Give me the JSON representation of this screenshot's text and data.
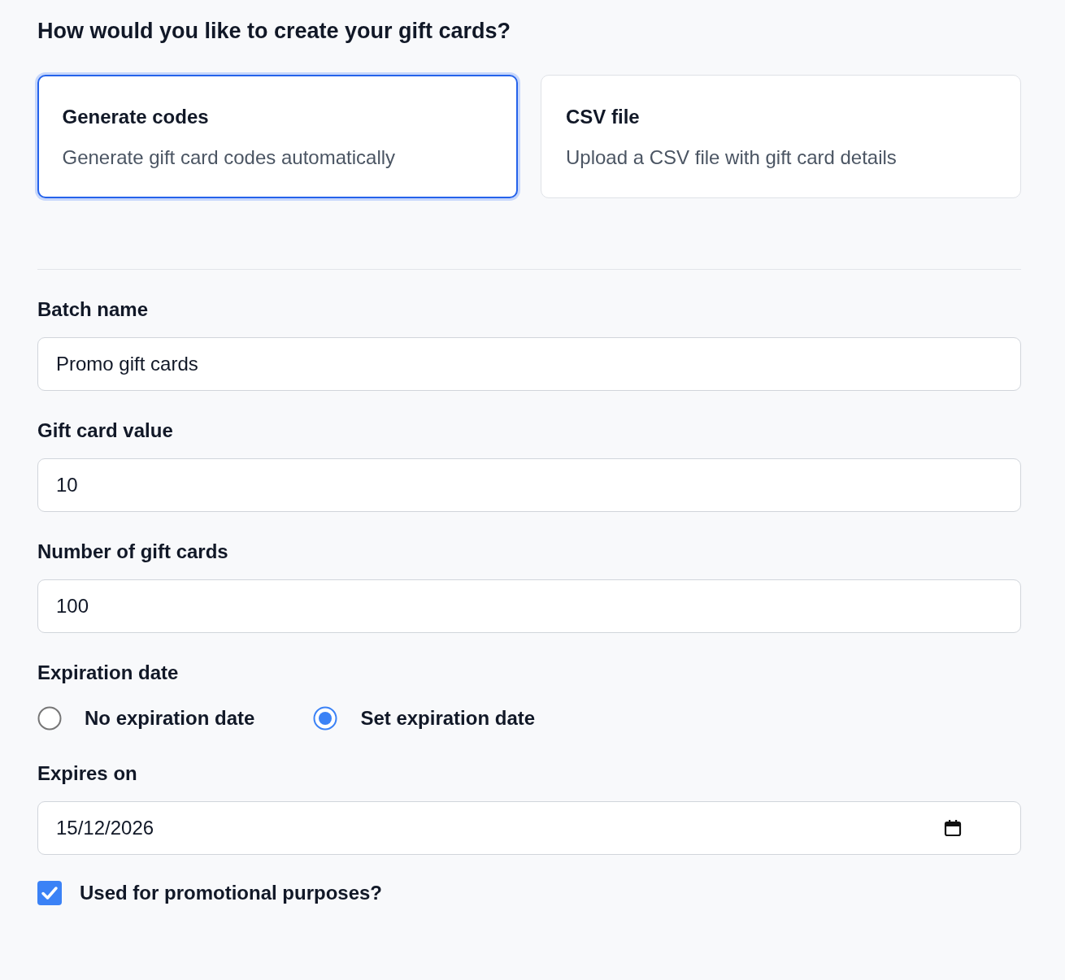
{
  "heading": "How would you like to create your gift cards?",
  "methods": [
    {
      "title": "Generate codes",
      "description": "Generate gift card codes automatically",
      "selected": true
    },
    {
      "title": "CSV file",
      "description": "Upload a CSV file with gift card details",
      "selected": false
    }
  ],
  "fields": [
    {
      "label": "Batch name",
      "value": "Promo gift cards"
    },
    {
      "label": "Gift card value",
      "value": "10"
    },
    {
      "label": "Number of gift cards",
      "value": "100"
    }
  ],
  "expiration": {
    "label": "Expiration date",
    "options": [
      {
        "label": "No expiration date",
        "selected": false
      },
      {
        "label": "Set expiration date",
        "selected": true
      }
    ]
  },
  "expires_on": {
    "label": "Expires on",
    "value": "15/12/2026"
  },
  "promotional": {
    "label": "Used for promotional purposes?",
    "checked": true
  }
}
